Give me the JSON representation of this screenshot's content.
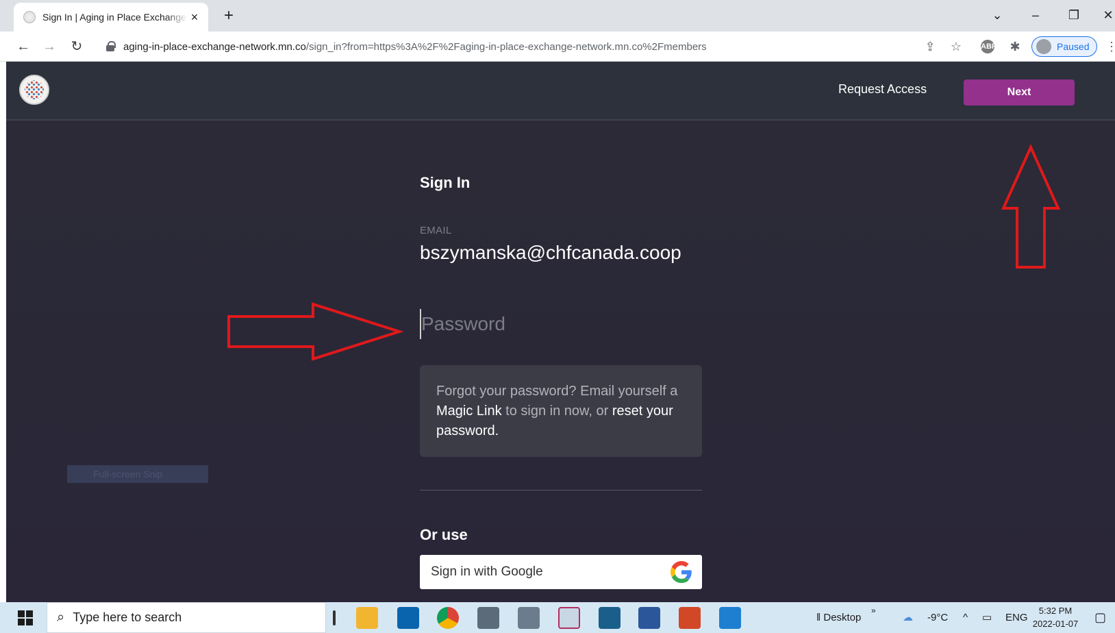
{
  "browser": {
    "tab_title": "Sign In | Aging in Place Exchange Network",
    "tab_close_glyph": "×",
    "new_tab_glyph": "+",
    "url_host": "aging-in-place-exchange-network.mn.co",
    "url_path": "/sign_in?from=https%3A%2F%2Faging-in-place-exchange-network.mn.co%2Fmembers",
    "profile_status": "Paused",
    "icons": [
      "back-icon",
      "forward-icon",
      "reload-icon",
      "lock-icon",
      "share-icon",
      "star-icon",
      "adblock-icon",
      "extensions-icon",
      "menu-icon"
    ]
  },
  "site": {
    "request_access": "Request Access",
    "next_label": "Next",
    "accent_color": "#93318d"
  },
  "signin": {
    "title": "Sign In",
    "email_label": "EMAIL",
    "email_value": "bszymanska@chfcanada.coop",
    "password_placeholder": "Password",
    "forgot_pre": "Forgot your password? Email yourself a ",
    "magic_link": "Magic Link",
    "forgot_mid": " to sign in now, or ",
    "reset_link": "reset your password",
    "forgot_post": ".",
    "or_use": "Or use",
    "google_label": "Sign in with Google"
  },
  "overlay": {
    "snip_tooltip": "Full-screen Snip",
    "annotation_color": "#e0191b"
  },
  "taskbar": {
    "search_placeholder": "Type here to search",
    "desktop_label": "Desktop",
    "overflow_glyph": "»",
    "temperature": "-9°C",
    "language": "ENG",
    "time": "5:32 PM",
    "date": "2022-01-07"
  }
}
